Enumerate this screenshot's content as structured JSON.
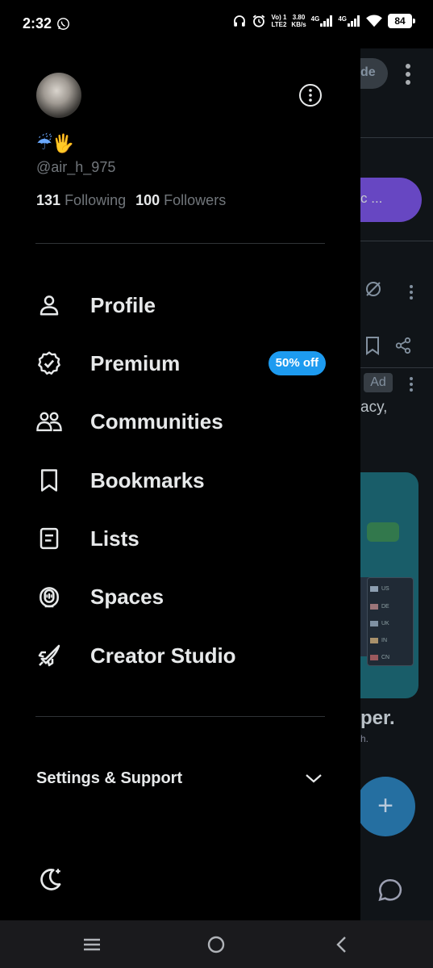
{
  "status_bar": {
    "time": "2:32",
    "volte_top": "Vo) 1",
    "volte_bottom": "LTE2",
    "speed_top": "3.80",
    "speed_bottom": "KB/s",
    "net1": "4G",
    "net2": "4G",
    "battery": "84"
  },
  "profile": {
    "emoji": "☔🖐",
    "handle": "@air_h_975",
    "following_count": "131",
    "following_label": "Following",
    "followers_count": "100",
    "followers_label": "Followers"
  },
  "menu": [
    {
      "label": "Profile",
      "icon": "person-icon"
    },
    {
      "label": "Premium",
      "icon": "verified-badge-icon",
      "badge": "50% off"
    },
    {
      "label": "Communities",
      "icon": "communities-icon"
    },
    {
      "label": "Bookmarks",
      "icon": "bookmark-icon"
    },
    {
      "label": "Lists",
      "icon": "list-icon"
    },
    {
      "label": "Spaces",
      "icon": "spaces-icon"
    },
    {
      "label": "Creator Studio",
      "icon": "rocket-icon"
    }
  ],
  "settings": {
    "label": "Settings & Support"
  },
  "background": {
    "pill_text": "de",
    "purple_text": "c ...",
    "ad_label": "Ad",
    "line1": "acy,",
    "line2": "per.",
    "line3": "h.",
    "flags": [
      "US",
      "DE",
      "UK",
      "IN",
      "CN"
    ],
    "fab": "+"
  },
  "colors": {
    "accent": "#1d9bf0",
    "background": "#000000",
    "text": "#e7e9ea",
    "muted": "#71767b"
  }
}
